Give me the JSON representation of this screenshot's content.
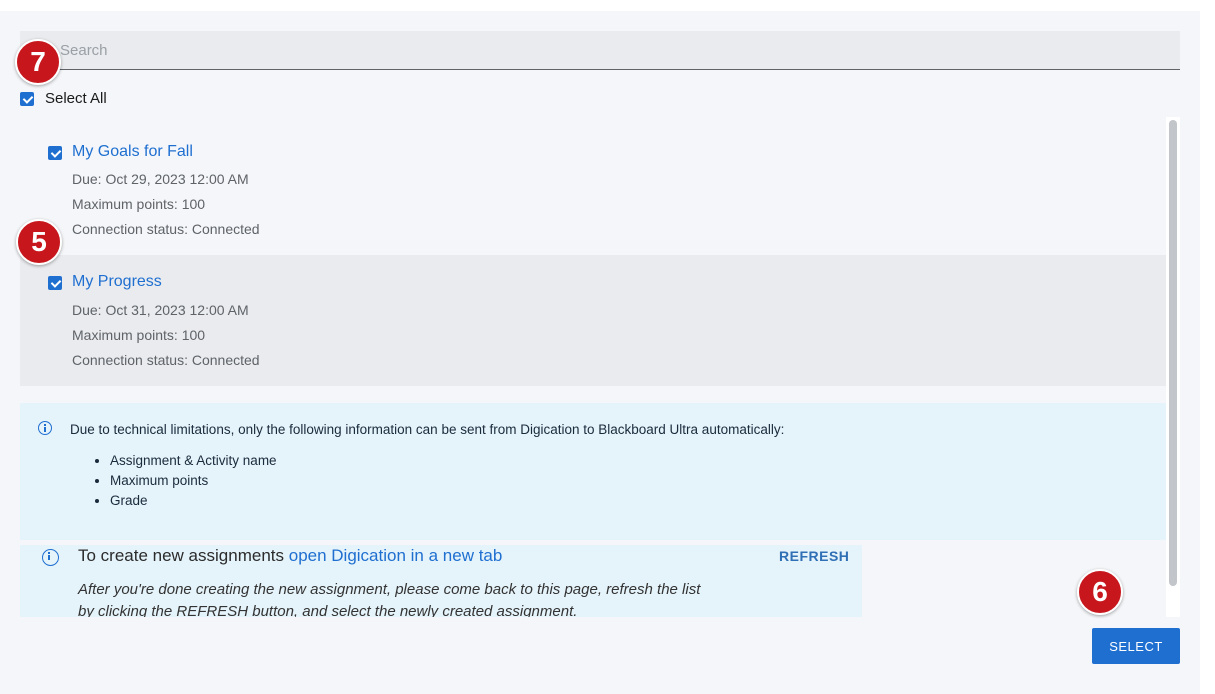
{
  "search": {
    "placeholder": "Search"
  },
  "select_all": {
    "label": "Select All",
    "checked": true
  },
  "assignments": [
    {
      "title": "My Goals for Fall",
      "due": "Due: Oct 29, 2023 12:00 AM",
      "max_points": "Maximum points: 100",
      "connection": "Connection status: Connected",
      "checked": true
    },
    {
      "title": "My Progress",
      "due": "Due: Oct 31, 2023 12:00 AM",
      "max_points": "Maximum points: 100",
      "connection": "Connection status: Connected",
      "checked": true
    }
  ],
  "notice": {
    "text": "Due to technical limitations, only the following information can be sent from Digication to Blackboard Ultra automatically:",
    "items": [
      "Assignment & Activity name",
      "Maximum points",
      "Grade"
    ]
  },
  "create": {
    "prefix": "To create new assignments",
    "link": "open Digication in a new tab",
    "refresh_label": "REFRESH",
    "note_line1": "After you're done creating the new assignment, please come back to this page, refresh the list",
    "note_line2": "by clicking the REFRESH button, and select the newly created assignment."
  },
  "select_button": {
    "label": "SELECT"
  },
  "badges": [
    "7",
    "5",
    "6"
  ],
  "colors": {
    "accent": "#1f6fd1",
    "badge": "#c8161d",
    "notice_bg": "#e5f3fa",
    "panel_bg": "#f4f6f9"
  }
}
